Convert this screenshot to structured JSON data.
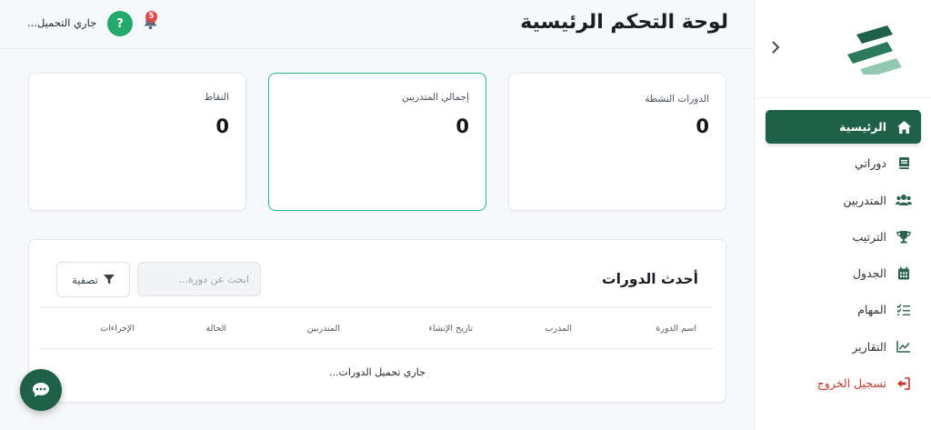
{
  "header": {
    "title": "لوحة التحكم الرئيسية",
    "user_status": "جاري التحميل...",
    "notifications_count": "5",
    "help_label": "?"
  },
  "sidebar": {
    "items": [
      {
        "label": "الرئيسية",
        "icon": "home-icon",
        "active": true
      },
      {
        "label": "دوراتي",
        "icon": "book-icon"
      },
      {
        "label": "المتدربين",
        "icon": "users-icon"
      },
      {
        "label": "الترتيب",
        "icon": "trophy-icon"
      },
      {
        "label": "الجدول",
        "icon": "calendar-icon"
      },
      {
        "label": "المهام",
        "icon": "tasks-icon"
      },
      {
        "label": "التقارير",
        "icon": "chart-line-icon"
      },
      {
        "label": "تسجيل الخروج",
        "icon": "sign-out-icon"
      }
    ]
  },
  "stats": [
    {
      "label": "الدورات النشطة",
      "value": "0"
    },
    {
      "label": "إجمالي المتدربين",
      "value": "0"
    },
    {
      "label": "النقاط",
      "value": "0"
    }
  ],
  "courses": {
    "title": "أحدث الدورات",
    "search_placeholder": "ابحث عن دورة...",
    "filter_label": "تصفية",
    "columns": [
      "اسم الدورة",
      "المدرب",
      "تاريخ الإنشاء",
      "المتدربين",
      "الحالة",
      "الإجراءات"
    ],
    "loading_text": "جاري تحميل الدورات..."
  },
  "colors": {
    "primary": "#1f6049",
    "accent_green": "#22a96b",
    "badge_red": "#e04848",
    "logout_red": "#c0392b",
    "highlight_border": "#2bb58a"
  }
}
